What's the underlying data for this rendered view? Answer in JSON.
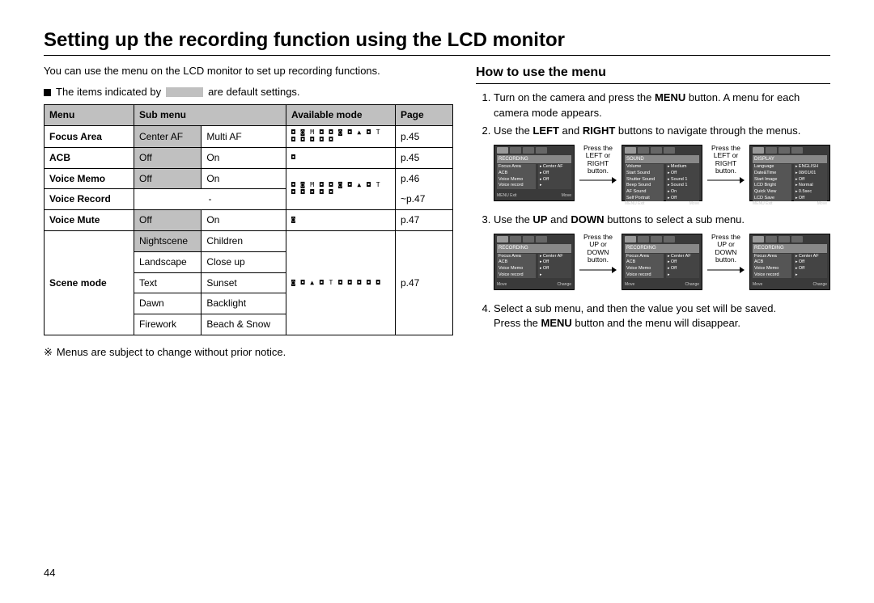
{
  "title": "Setting up the recording function using the LCD monitor",
  "intro": "You can use the menu on the LCD monitor to set up recording functions.",
  "default_note_pre": "The items indicated by",
  "default_note_post": "are default settings.",
  "table": {
    "headers": {
      "menu": "Menu",
      "sub": "Sub menu",
      "mode": "Available mode",
      "page": "Page"
    },
    "rows": {
      "focus_area": {
        "menu": "Focus Area",
        "sub1": "Center AF",
        "sub2": "Multi AF",
        "page": "p.45"
      },
      "acb": {
        "menu": "ACB",
        "sub1": "Off",
        "sub2": "On",
        "page": "p.45"
      },
      "voice_memo": {
        "menu": "Voice Memo",
        "sub1": "Off",
        "sub2": "On",
        "page": "p.46"
      },
      "voice_record": {
        "menu": "Voice Record",
        "sub1": "-",
        "page": "~p.47"
      },
      "voice_mute": {
        "menu": "Voice Mute",
        "sub1": "Off",
        "sub2": "On",
        "page": "p.47"
      },
      "scene": {
        "menu": "Scene mode",
        "page": "p.47",
        "r1": {
          "a": "Nightscene",
          "b": "Children"
        },
        "r2": {
          "a": "Landscape",
          "b": "Close up"
        },
        "r3": {
          "a": "Text",
          "b": "Sunset"
        },
        "r4": {
          "a": "Dawn",
          "b": "Backlight"
        },
        "r5": {
          "a": "Firework",
          "b": "Beach & Snow"
        }
      }
    }
  },
  "footnote": "Menus are subject to change without prior notice.",
  "page_number": "44",
  "howto_title": "How to use the menu",
  "steps": {
    "s1_a": "Turn on the camera and press the ",
    "s1_b": "MENU",
    "s1_c": " button. A menu for each camera mode appears.",
    "s2_a": "Use the ",
    "s2_b": "LEFT",
    "s2_c": " and ",
    "s2_d": "RIGHT",
    "s2_e": " buttons to navigate through the menus.",
    "s3_a": "Use the ",
    "s3_b": "UP",
    "s3_c": " and ",
    "s3_d": "DOWN",
    "s3_e": " buttons to select a sub menu.",
    "s4_a": "Select a sub menu, and then the value you set will be saved.",
    "s4_b": "Press the ",
    "s4_c": "MENU",
    "s4_d": " button and the menu will disappear."
  },
  "captions": {
    "lr": "Press the LEFT or RIGHT button.",
    "ud": "Press the UP or DOWN button."
  },
  "mini": {
    "recording": {
      "title": "RECORDING",
      "items": [
        {
          "l": "Focus Area",
          "v": "Center AF"
        },
        {
          "l": "ACB",
          "v": "Off"
        },
        {
          "l": "Voice Memo",
          "v": "Off"
        },
        {
          "l": "Voice record",
          "v": ""
        }
      ],
      "foot_l": "MENU  Exit",
      "foot_r": "Move"
    },
    "sound": {
      "title": "SOUND",
      "items": [
        {
          "l": "Volume",
          "v": "Medium"
        },
        {
          "l": "Start Sound",
          "v": "Off"
        },
        {
          "l": "Shutter Sound",
          "v": "Sound 1"
        },
        {
          "l": "Beep Sound",
          "v": "Sound 1"
        },
        {
          "l": "AF Sound",
          "v": "On"
        },
        {
          "l": "Self Portrait",
          "v": "Off"
        }
      ],
      "foot_l": "MENU  Exit",
      "foot_r": "Move"
    },
    "display": {
      "title": "DISPLAY",
      "items": [
        {
          "l": "Language",
          "v": "ENGLISH"
        },
        {
          "l": "Date&Time",
          "v": "08/01/01"
        },
        {
          "l": "Start Image",
          "v": "Off"
        },
        {
          "l": "LCD Bright",
          "v": "Normal"
        },
        {
          "l": "Quick View",
          "v": "0.5sec"
        },
        {
          "l": "LCD Save",
          "v": "Off"
        }
      ],
      "foot_l": "MENU  Exit",
      "foot_r": "Move"
    },
    "rec2a": {
      "title": "RECORDING",
      "items": [
        {
          "l": "Focus Area",
          "v": "Center AF"
        },
        {
          "l": "ACB",
          "v": "Off"
        },
        {
          "l": "Voice Memo",
          "v": "Off"
        },
        {
          "l": "Voice record",
          "v": ""
        }
      ],
      "foot_l": "Move",
      "foot_r": "Change"
    },
    "rec2b": {
      "title": "RECORDING",
      "items": [
        {
          "l": "Focus Area",
          "v": "Center AF"
        },
        {
          "l": "ACB",
          "v": "Off"
        },
        {
          "l": "Voice Memo",
          "v": "Off"
        },
        {
          "l": "Voice record",
          "v": ""
        }
      ],
      "foot_l": "Move",
      "foot_r": "Change"
    },
    "rec2c": {
      "title": "RECORDING",
      "items": [
        {
          "l": "Focus Area",
          "v": "Center AF"
        },
        {
          "l": "ACB",
          "v": "Off"
        },
        {
          "l": "Voice Memo",
          "v": "Off"
        },
        {
          "l": "Voice record",
          "v": ""
        }
      ],
      "foot_l": "Move",
      "foot_r": "Change"
    }
  },
  "mode_icons": {
    "full": "◘ ◙ M ◘ ◘\n◙ ◘ ▲ ◘ T\n◘ ◘ ◘ ◘ ◘",
    "single": "◘",
    "movie": "◙",
    "scene_block": "◙ ◘ ▲ ◘ T\n◘ ◘ ◘ ◘ ◘"
  }
}
